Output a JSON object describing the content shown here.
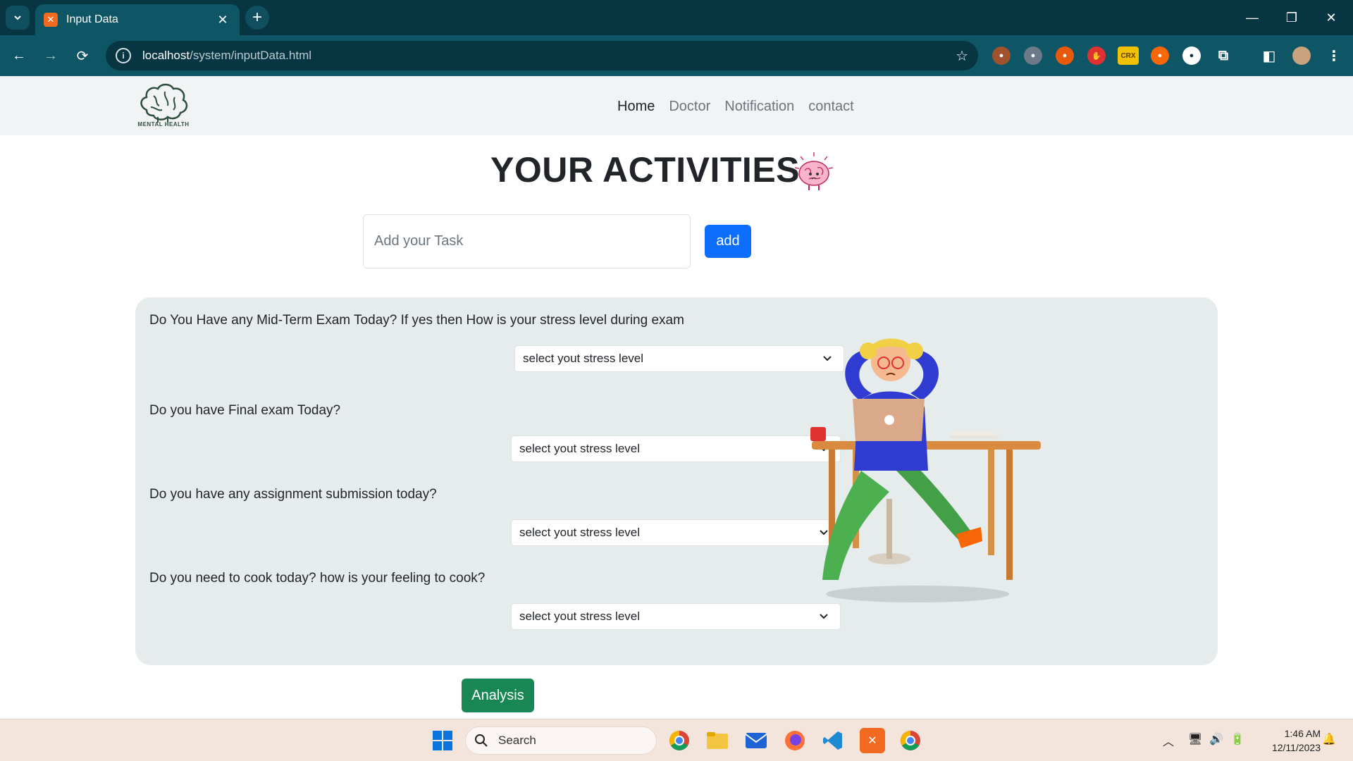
{
  "browser": {
    "tab_title": "Input Data",
    "url_host": "localhost",
    "url_path": "/system/inputData.html",
    "ext_crx_label": "CRX"
  },
  "site": {
    "logo_text": "MENTAL HEALTH",
    "nav": [
      {
        "label": "Home",
        "active": true
      },
      {
        "label": "Doctor",
        "active": false
      },
      {
        "label": "Notification",
        "active": false
      },
      {
        "label": "contact",
        "active": false
      }
    ]
  },
  "main": {
    "title": "YOUR ACTIVITIES",
    "task_placeholder": "Add your Task",
    "task_value": "",
    "add_label": "add",
    "questions": [
      {
        "label": "Do You Have any Mid-Term Exam Today? If yes then How is your stress level during exam",
        "select_value": "select yout stress level"
      },
      {
        "label": "Do you have Final exam Today?",
        "select_value": "select yout stress level"
      },
      {
        "label": "Do you have any assignment submission today?",
        "select_value": "select yout stress level"
      },
      {
        "label": "Do you need to cook today? how is your feeling to cook?",
        "select_value": "select yout stress level"
      }
    ],
    "analysis_label": "Analysis"
  },
  "taskbar": {
    "search_label": "Search",
    "time": "1:46 AM",
    "date": "12/11/2023"
  },
  "colors": {
    "chrome_dark": "#073642",
    "chrome_tab": "#0e5566",
    "primary": "#0d6efd",
    "success": "#198754",
    "panel_bg": "#e6ebec"
  }
}
